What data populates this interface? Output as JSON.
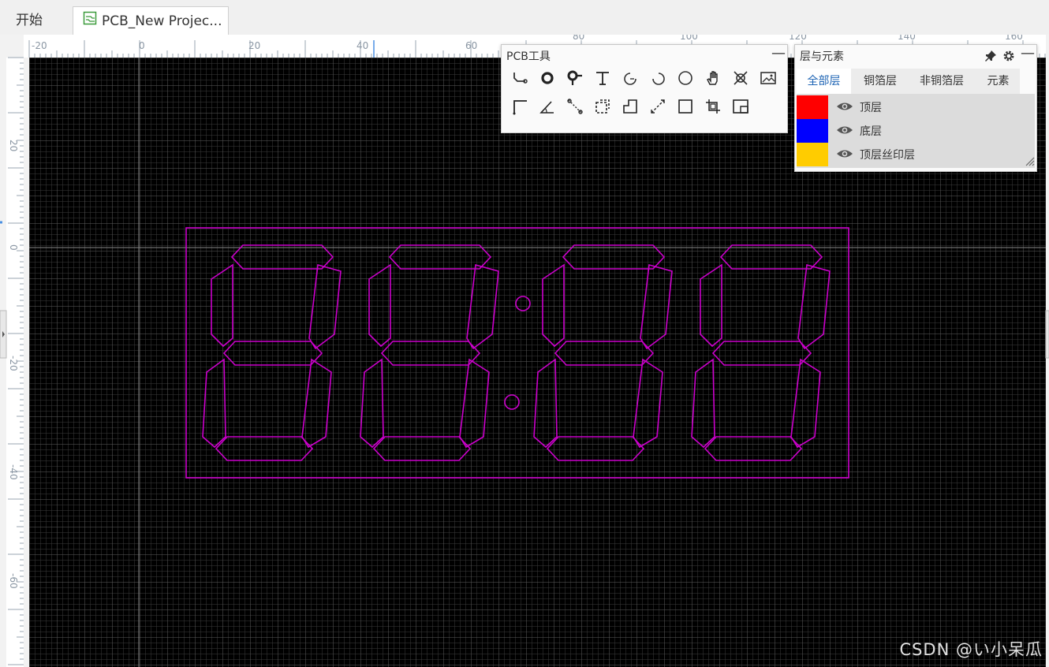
{
  "tabs": {
    "home": "开始",
    "project": "PCB_New Projec..."
  },
  "ruler": {
    "top_labels": [
      "-20",
      "0",
      "20",
      "40",
      "60",
      "80",
      "100",
      "120",
      "140",
      "160"
    ],
    "left_labels": [
      "20",
      "0",
      "-20",
      "-40",
      "-60"
    ]
  },
  "pcb_tools": {
    "title": "PCB工具",
    "tools_row1": [
      "track-icon",
      "pad-icon",
      "via-icon",
      "text-icon",
      "arc-icon",
      "arc-ccw-icon",
      "circle-icon",
      "hand-icon",
      "no-connect-icon",
      "image-icon"
    ],
    "tools_row2": [
      "corner-line-icon",
      "angle-icon",
      "dimension-icon",
      "rect-select-icon",
      "solid-region-icon",
      "measure-icon",
      "rectangle-icon",
      "crop-icon",
      "canvas-origin-icon"
    ]
  },
  "layers": {
    "title": "层与元素",
    "tabs": [
      "全部层",
      "铜箔层",
      "非铜箔层",
      "元素"
    ],
    "items": [
      {
        "name": "顶层",
        "color": "#ff0000"
      },
      {
        "name": "底层",
        "color": "#0000ff"
      },
      {
        "name": "顶层丝印层",
        "color": "#ffcc00"
      }
    ]
  },
  "colors": {
    "silkscreen": "#cc00cc",
    "canvas": "#000000",
    "grid": "#4a4a4a"
  },
  "watermark": "CSDN @い小呆瓜"
}
